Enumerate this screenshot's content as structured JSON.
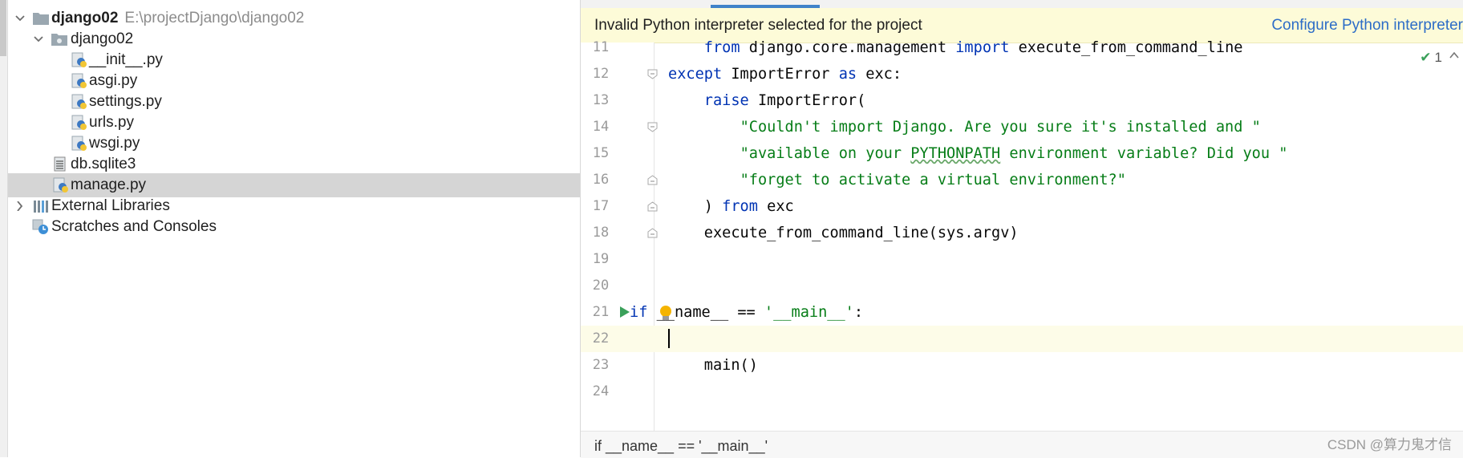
{
  "project_tree": {
    "root": {
      "name": "django02",
      "path": "E:\\projectDjango\\django02"
    },
    "items": [
      {
        "label": "django02",
        "type": "folder"
      },
      {
        "label": "__init__.py",
        "type": "python-file"
      },
      {
        "label": "asgi.py",
        "type": "python-file"
      },
      {
        "label": "settings.py",
        "type": "python-file"
      },
      {
        "label": "urls.py",
        "type": "python-file"
      },
      {
        "label": "wsgi.py",
        "type": "python-file"
      },
      {
        "label": "db.sqlite3",
        "type": "db-file"
      },
      {
        "label": "manage.py",
        "type": "python-file",
        "selected": true
      },
      {
        "label": "External Libraries",
        "type": "libraries"
      },
      {
        "label": "Scratches and Consoles",
        "type": "scratches"
      }
    ]
  },
  "editor": {
    "banner": {
      "message": "Invalid Python interpreter selected for the project",
      "link": "Configure Python interpreter"
    },
    "inspection_count": "1",
    "lines": [
      {
        "n": "11",
        "text": "        from django.core.management import execute_from_command_line"
      },
      {
        "n": "12",
        "text": "    except ImportError as exc:"
      },
      {
        "n": "13",
        "text": "        raise ImportError("
      },
      {
        "n": "14",
        "text": "            \"Couldn't import Django. Are you sure it's installed and \""
      },
      {
        "n": "15",
        "text": "            \"available on your PYTHONPATH environment variable? Did you \""
      },
      {
        "n": "16",
        "text": "            \"forget to activate a virtual environment?\""
      },
      {
        "n": "17",
        "text": "        ) from exc"
      },
      {
        "n": "18",
        "text": "    execute_from_command_line(sys.argv)"
      },
      {
        "n": "19",
        "text": ""
      },
      {
        "n": "20",
        "text": ""
      },
      {
        "n": "21",
        "text": "if __name__ == '__main__':"
      },
      {
        "n": "22",
        "text": ""
      },
      {
        "n": "23",
        "text": "    main()"
      },
      {
        "n": "24",
        "text": ""
      }
    ],
    "breadcrumb": "if __name__ == '__main__'"
  },
  "watermark": "CSDN @算力鬼才信",
  "colors": {
    "keyword": "#0033b3",
    "string": "#067d17",
    "banner_bg": "#fdfbd8",
    "link": "#2d6dc7",
    "selection": "#d5d5d5"
  }
}
